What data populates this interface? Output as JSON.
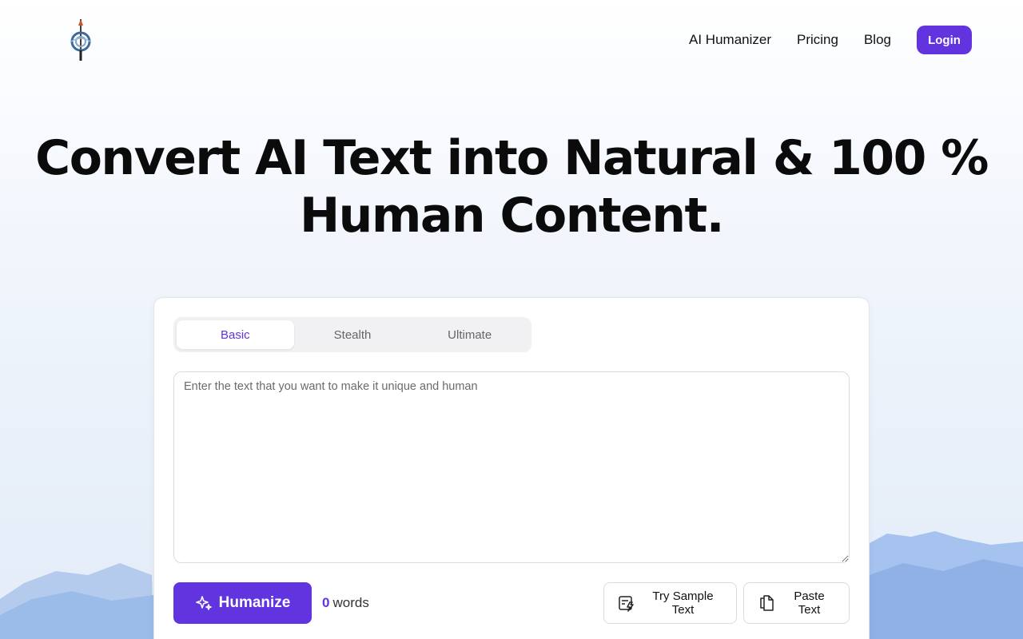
{
  "header": {
    "logo_icon": "pen-compass-logo-icon",
    "nav": [
      {
        "label": "AI Humanizer"
      },
      {
        "label": "Pricing"
      },
      {
        "label": "Blog"
      }
    ],
    "login_label": "Login"
  },
  "hero": {
    "line1": "Convert AI Text into Natural & 100 %",
    "line2": "Human Content."
  },
  "tool": {
    "tabs": [
      {
        "label": "Basic",
        "active": true
      },
      {
        "label": "Stealth",
        "active": false
      },
      {
        "label": "Ultimate",
        "active": false
      }
    ],
    "input": {
      "value": "",
      "placeholder": "Enter the text that you want to make it unique and human"
    },
    "humanize_label": "Humanize",
    "humanize_icon": "sparkles-icon",
    "word_count": "0",
    "word_unit": "words",
    "sample_label": "Try Sample Text",
    "sample_icon": "sample-text-icon",
    "paste_label": "Paste Text",
    "paste_icon": "paste-icon"
  },
  "colors": {
    "accent": "#6234e0",
    "mountain_light": "#a9c3ec",
    "mountain_dark": "#8fb1e6"
  }
}
